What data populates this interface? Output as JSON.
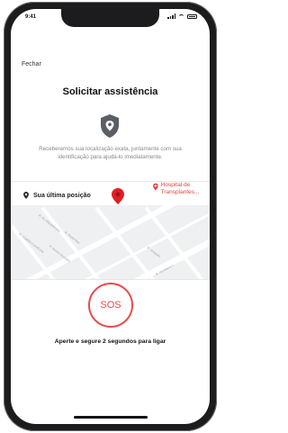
{
  "status": {
    "time": "9:41"
  },
  "header": {
    "close_label": "Fechar",
    "title": "Solicitar assistência"
  },
  "description": "Receberemos sua localização exata, juntamente com sua identificação para ajudá-lo imediatamente.",
  "location": {
    "heading": "Sua última posição",
    "poi_label": "Hospital de Transplantes...",
    "streets": [
      "R. Dr. Albuquerque",
      "R. Paula Ney",
      "R. Bueno Brandão",
      "R. Joaquim",
      "R. Capitão Cavalcanti",
      "R. Humberto I"
    ]
  },
  "sos": {
    "label": "SOS",
    "hint": "Aperte e segure 2 segundos para ligar"
  },
  "colors": {
    "accent": "#e94a4a",
    "poi": "#e0463f",
    "shield": "#5a5f66"
  },
  "icons": [
    "shield-icon",
    "location-pin-icon",
    "map-marker-icon",
    "hospital-pin-icon"
  ]
}
